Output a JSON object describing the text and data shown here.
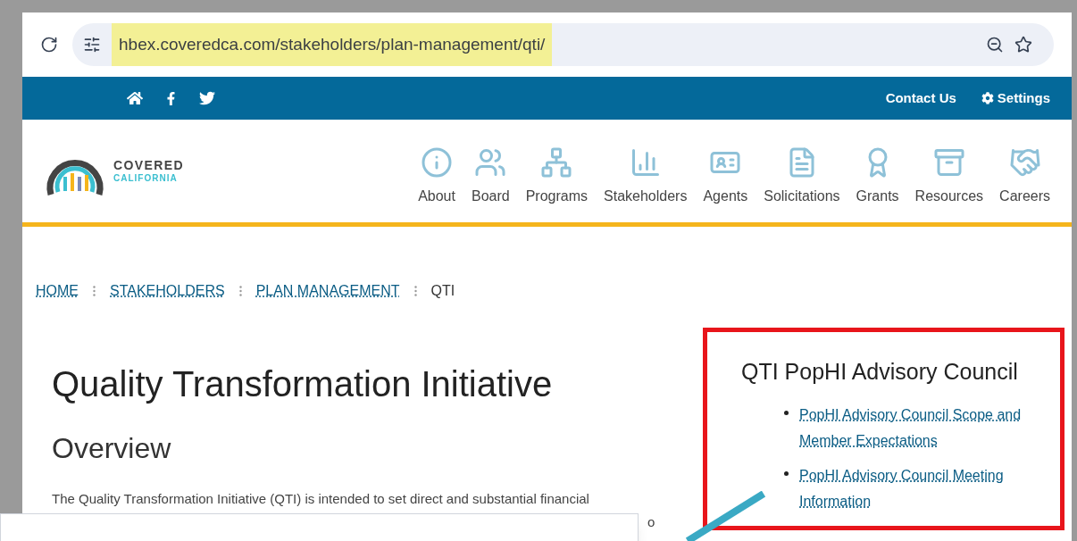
{
  "browser": {
    "url": "hbex.coveredca.com/stakeholders/plan-management/qti/"
  },
  "top_bar": {
    "links": [
      "Contact Us",
      "Settings"
    ]
  },
  "logo": {
    "line_1": "COVERED",
    "line_2": "CALIFORNIA"
  },
  "nav": [
    {
      "label": "About",
      "kind": "info"
    },
    {
      "label": "Board",
      "kind": "people"
    },
    {
      "label": "Programs",
      "kind": "tree"
    },
    {
      "label": "Stakeholders",
      "kind": "chart"
    },
    {
      "label": "Agents",
      "kind": "badge"
    },
    {
      "label": "Solicitations",
      "kind": "document"
    },
    {
      "label": "Grants",
      "kind": "award"
    },
    {
      "label": "Resources",
      "kind": "archive"
    },
    {
      "label": "Careers",
      "kind": "handshake"
    }
  ],
  "breadcrumb": [
    "HOME",
    "STAKEHOLDERS",
    "PLAN MANAGEMENT",
    "QTI"
  ],
  "title": "Quality Transformation Initiative",
  "section_heading": "Overview",
  "paragraph": "The Quality Transformation Initiative (QTI) is intended to set direct and substantial financial",
  "paragraph_fragment": "o",
  "sidebar": {
    "heading": "QTI PopHI Advisory Council",
    "links": [
      "PopHI Advisory Council Scope and Member Expectations",
      "PopHI Advisory Council Meeting Information"
    ]
  }
}
